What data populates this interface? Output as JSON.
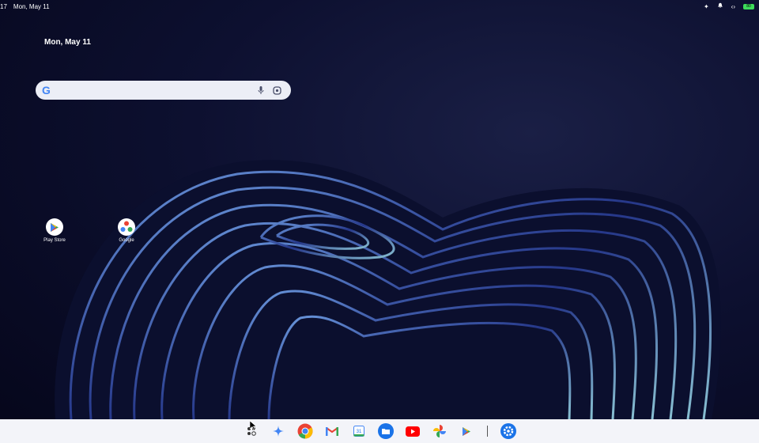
{
  "status_bar": {
    "time": "17",
    "date": "Mon, May 11",
    "battery_label": "80"
  },
  "desktop": {
    "date": "Mon, May 11",
    "search": {
      "placeholder": "",
      "g_label": "G"
    },
    "icons": [
      {
        "label": "Play Store",
        "icon": "play-store-icon"
      },
      {
        "label": "Google",
        "icon": "google-folder-icon"
      }
    ]
  },
  "shelf": {
    "items": [
      {
        "name": "launcher",
        "icon": "launcher-icon"
      },
      {
        "name": "gemini",
        "icon": "gemini-sparkle-icon",
        "color": "#4285f4"
      },
      {
        "name": "chrome",
        "icon": "chrome-icon"
      },
      {
        "name": "gmail",
        "icon": "gmail-icon"
      },
      {
        "name": "calendar",
        "icon": "calendar-icon",
        "label": "31"
      },
      {
        "name": "files",
        "icon": "files-icon",
        "color": "#1a73e8"
      },
      {
        "name": "youtube",
        "icon": "youtube-icon",
        "color": "#ff0000"
      },
      {
        "name": "photos",
        "icon": "photos-icon"
      },
      {
        "name": "play-store",
        "icon": "play-store-icon"
      },
      {
        "name": "settings",
        "icon": "settings-gear-icon",
        "color": "#1a73e8"
      }
    ]
  }
}
